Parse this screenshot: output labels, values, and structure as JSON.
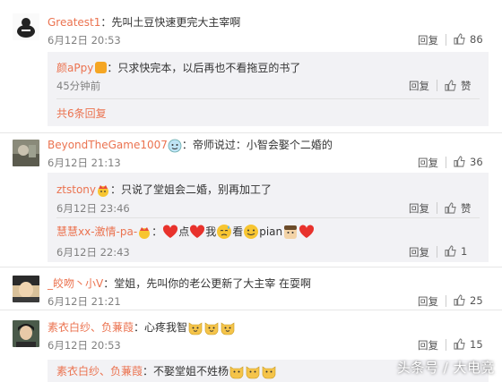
{
  "comments": [
    {
      "user": "Greatest1",
      "text": "：先叫土豆快速更完大主宰啊",
      "time": "6月12日 20:53",
      "reply": "回复",
      "likes": "86"
    },
    {
      "user": "BeyondTheGame1007",
      "text": "：帝师说过：小智会娶个二婚的",
      "time": "6月12日 21:13",
      "reply": "回复",
      "likes": "36"
    },
    {
      "user": "_皎吻丶小V",
      "text": "：堂姐，先叫你的老公更新了大主宰 在耍啊",
      "time": "6月12日 21:21",
      "reply": "回复",
      "likes": "25"
    },
    {
      "user": "素衣白纱、负蒹葭",
      "text": "：心疼我智",
      "time": "6月12日 20:53",
      "reply": "回复",
      "likes": "15"
    }
  ],
  "subreplies": {
    "c1": [
      {
        "user": "颜aPpy",
        "text": "：只求快完本，以后再也不看拖豆的书了",
        "time": "45分钟前",
        "reply": "回复",
        "likes": "赞"
      }
    ],
    "c1_more": "共6条回复",
    "c2": [
      {
        "user": "ztstony",
        "text": "：只说了堂姐会二婚，别再加工了",
        "time": "6月12日 23:46",
        "reply": "回复",
        "likes": "赞"
      },
      {
        "user": "慧慧xx-激情-pa-",
        "text_parts": [
          "点",
          "我",
          "看",
          "pian"
        ],
        "time": "6月12日 22:43",
        "reply": "回复",
        "likes": "1"
      }
    ],
    "c4": [
      {
        "user": "素衣白纱、负蒹葭",
        "text": "：不娶堂姐不姓杨"
      }
    ]
  },
  "watermark": "头条号 / 大电竞",
  "colors": {
    "username": "#eb7350",
    "text": "#333333",
    "time": "#808080",
    "subbg": "#f2f2f5"
  }
}
